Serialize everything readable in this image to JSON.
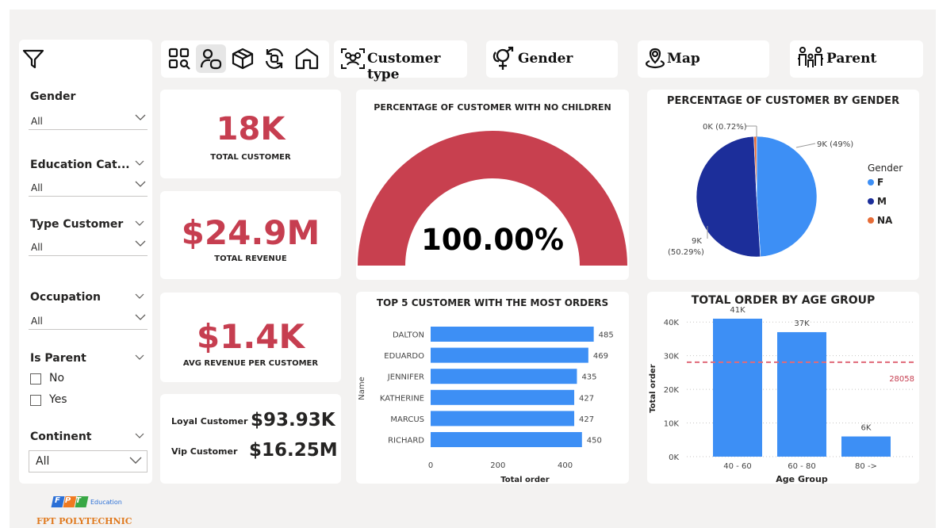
{
  "filters": {
    "gender": {
      "label": "Gender",
      "value": "All"
    },
    "education": {
      "label": "Education Cat...",
      "value": "All"
    },
    "type_customer": {
      "label": "Type Customer",
      "value": "All"
    },
    "occupation": {
      "label": "Occupation",
      "value": "All"
    },
    "is_parent": {
      "label": "Is Parent",
      "options": [
        "No",
        "Yes"
      ]
    },
    "continent": {
      "label": "Continent",
      "value": "All"
    }
  },
  "nav": {
    "customer_type": "Customer type",
    "gender": "Gender",
    "map": "Map",
    "parent": "Parent"
  },
  "kpis": {
    "total_customer": {
      "value": "18K",
      "label": "TOTAL CUSTOMER"
    },
    "total_revenue": {
      "value": "$24.9M",
      "label": "TOTAL REVENUE"
    },
    "avg_revenue": {
      "value": "$1.4K",
      "label": "AVG REVENUE PER CUSTOMER"
    },
    "loyal": {
      "label": "Loyal Customer",
      "value": "$93.93K"
    },
    "vip": {
      "label": "Vip Customer",
      "value": "$16.25M"
    }
  },
  "logo": {
    "brand": "FPT",
    "edu": "Education",
    "school": "FPT POLYTECHNIC"
  },
  "colors": {
    "accent": "#c63e50",
    "blue": "#3d8ff5",
    "navy": "#1c2e9a",
    "orange": "#e66c37",
    "gauge": "#c8404f"
  },
  "chart_data": [
    {
      "type": "gauge",
      "title": "PERCENTAGE OF CUSTOMER WITH NO CHILDREN",
      "value": 100.0,
      "value_label": "100.00%",
      "range": [
        0,
        100
      ]
    },
    {
      "type": "pie",
      "title": "PERCENTAGE OF CUSTOMER BY GENDER",
      "legend_title": "Gender",
      "legend_position": "right",
      "categories": [
        "F",
        "M",
        "NA"
      ],
      "values": [
        49,
        50.29,
        0.72
      ],
      "data_labels": [
        "9K (49%)",
        "9K (50.29%)",
        "0K (0.72%)"
      ]
    },
    {
      "type": "bar",
      "orientation": "horizontal",
      "title": "TOP 5 CUSTOMER WITH THE MOST ORDERS",
      "xlabel": "Total order",
      "ylabel": "Name",
      "categories": [
        "DALTON",
        "EDUARDO",
        "JENNIFER",
        "KATHERINE",
        "MARCUS",
        "RICHARD"
      ],
      "values": [
        485,
        469,
        435,
        427,
        427,
        450
      ],
      "xlim": [
        0,
        500
      ],
      "xticks": [
        0,
        200,
        400
      ]
    },
    {
      "type": "bar",
      "title": "TOTAL ORDER BY AGE GROUP",
      "xlabel": "Age Group",
      "ylabel": "Total order",
      "categories": [
        "40 - 60",
        "60 - 80",
        "80 ->"
      ],
      "values": [
        41000,
        37000,
        6000
      ],
      "data_labels": [
        "41K",
        "37K",
        "6K"
      ],
      "ylim": [
        0,
        45000
      ],
      "yticks": [
        "0K",
        "10K",
        "20K",
        "30K",
        "40K"
      ],
      "reference_line": {
        "value": 28058,
        "label": "28058"
      },
      "grid": true
    }
  ]
}
